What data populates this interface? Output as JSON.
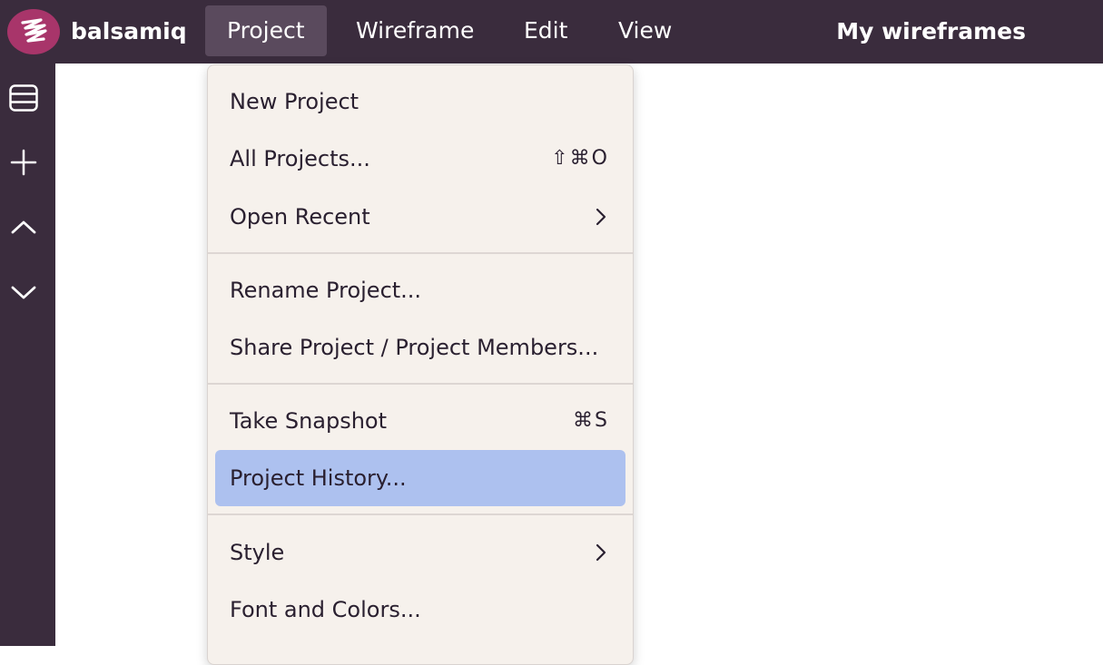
{
  "app": {
    "brand": "balsamiq",
    "workspace_title": "My wireframes"
  },
  "menubar": {
    "items": [
      {
        "label": "Project",
        "active": true
      },
      {
        "label": "Wireframe",
        "active": false
      },
      {
        "label": "Edit",
        "active": false
      },
      {
        "label": "View",
        "active": false
      }
    ]
  },
  "sidebar": {
    "buttons": [
      {
        "icon": "panel-list-icon"
      },
      {
        "icon": "plus-icon"
      },
      {
        "icon": "chevron-up-icon"
      },
      {
        "icon": "chevron-down-icon"
      }
    ]
  },
  "dropdown": {
    "items": [
      {
        "label": "New Project",
        "shortcut": ""
      },
      {
        "label": "All Projects...",
        "shortcut": "⇧⌘O"
      },
      {
        "label": "Open Recent",
        "submenu": true
      },
      {
        "label": "Rename Project...",
        "shortcut": ""
      },
      {
        "label": "Share Project / Project Members...",
        "shortcut": ""
      },
      {
        "label": "Take Snapshot",
        "shortcut": "⌘S"
      },
      {
        "label": "Project History...",
        "highlighted": true
      },
      {
        "label": "Style",
        "submenu": true
      },
      {
        "label": "Font and Colors...",
        "shortcut": ""
      }
    ]
  },
  "colors": {
    "topbar": "#3a2c3d",
    "logo": "#a8356a",
    "menu_active": "#5a4a5d",
    "dropdown_bg": "#f6f1ec",
    "highlight": "#adc1ef"
  }
}
